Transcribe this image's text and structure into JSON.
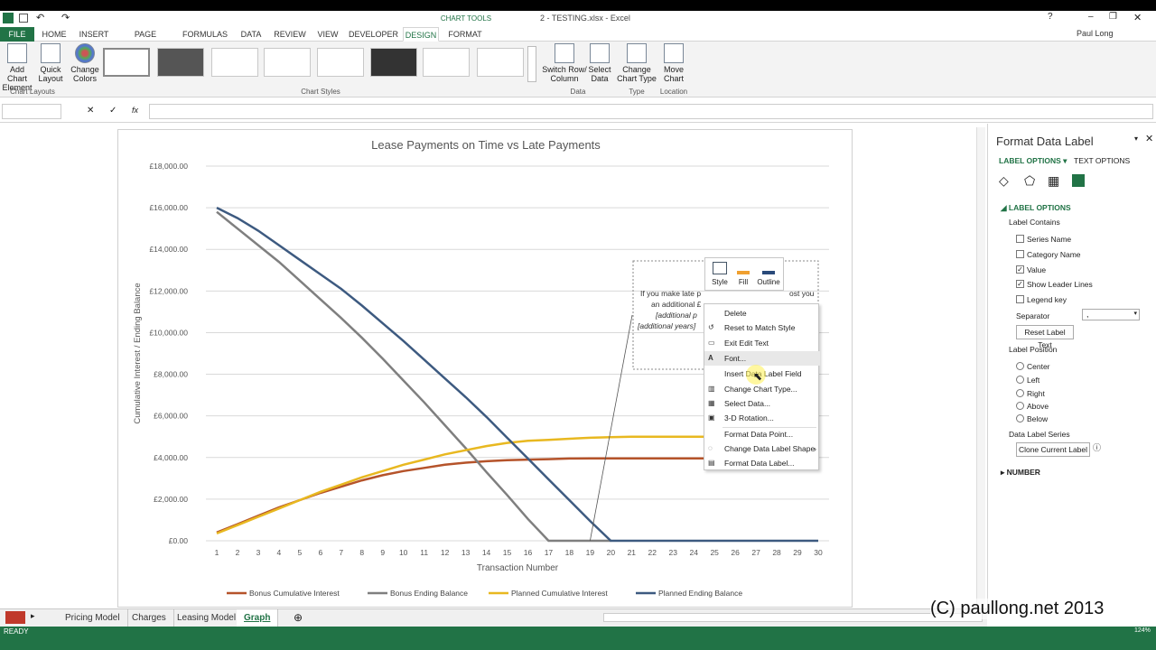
{
  "window": {
    "title": "2 - TESTING.xlsx - Excel",
    "user": "Paul Long",
    "chart_tools": "CHART TOOLS"
  },
  "tabs": [
    "HOME",
    "INSERT",
    "PAGE LAYOUT",
    "FORMULAS",
    "DATA",
    "REVIEW",
    "VIEW",
    "DEVELOPER",
    "DESIGN",
    "FORMAT"
  ],
  "file_tab": "FILE",
  "ribbon": {
    "add_chart_element": "Add Chart\nElement",
    "quick_layout": "Quick\nLayout",
    "change_colors": "Change\nColors",
    "switch_row_col": "Switch Row/\nColumn",
    "select_data": "Select\nData",
    "change_chart_type": "Change\nChart Type",
    "move_chart": "Move\nChart",
    "groups": {
      "chart_layouts": "Chart Layouts",
      "chart_styles": "Chart Styles",
      "data": "Data",
      "type": "Type",
      "location": "Location"
    }
  },
  "formula_bar": {
    "cancel": "✕",
    "enter": "✓",
    "fx": "fx",
    "name_box": "",
    "formula": ""
  },
  "chart_data": {
    "type": "line",
    "title": "Lease Payments on Time vs Late Payments",
    "xlabel": "Transaction Number",
    "ylabel": "Cumulative Interest / Ending Balance",
    "x": [
      1,
      2,
      3,
      4,
      5,
      6,
      7,
      8,
      9,
      10,
      11,
      12,
      13,
      14,
      15,
      16,
      17,
      18,
      19,
      20,
      21,
      22,
      23,
      24,
      25,
      26,
      27,
      28,
      29,
      30
    ],
    "ylim": [
      0,
      18000
    ],
    "yticks": [
      "£0.00",
      "£2,000.00",
      "£4,000.00",
      "£6,000.00",
      "£8,000.00",
      "£10,000.00",
      "£12,000.00",
      "£14,000.00",
      "£16,000.00",
      "£18,000.00"
    ],
    "grid": true,
    "legend_placement": "bottom",
    "series": [
      {
        "name": "Bonus Cumulative Interest",
        "color": "#b5532a",
        "values": [
          400,
          800,
          1200,
          1600,
          1950,
          2300,
          2600,
          2900,
          3150,
          3350,
          3500,
          3650,
          3750,
          3820,
          3870,
          3900,
          3920,
          3950,
          3960,
          3960,
          3960,
          3960,
          3960,
          3960,
          3960,
          3960,
          3960,
          3960,
          3960,
          3960
        ]
      },
      {
        "name": "Bonus Ending Balance",
        "color": "#7f7f7f",
        "values": [
          15800,
          15000,
          14200,
          13400,
          12500,
          11600,
          10700,
          9750,
          8750,
          7700,
          6650,
          5550,
          4450,
          3300,
          2200,
          1050,
          0,
          0,
          0,
          0
        ]
      },
      {
        "name": "Planned Cumulative Interest",
        "color": "#e8b820",
        "values": [
          350,
          750,
          1150,
          1550,
          1950,
          2350,
          2700,
          3050,
          3350,
          3650,
          3900,
          4150,
          4350,
          4550,
          4700,
          4800,
          4850,
          4900,
          4950,
          4980,
          5000,
          5000,
          5000,
          5000,
          5000,
          5000,
          5000,
          5000,
          5000,
          5000
        ]
      },
      {
        "name": "Planned Ending Balance",
        "color": "#3d5a80",
        "values": [
          16000,
          15500,
          14900,
          14200,
          13500,
          12800,
          12100,
          11300,
          10450,
          9600,
          8700,
          7800,
          6900,
          5950,
          4950,
          3950,
          2950,
          1950,
          950,
          0,
          0,
          0,
          0,
          0,
          0,
          0,
          0,
          0,
          0,
          0
        ]
      }
    ],
    "annotation": {
      "line1": "If you make late p",
      "line1b": "ost you",
      "line2": "an additional £",
      "line3": "[additional p",
      "line4": "[additional years]"
    }
  },
  "mini_toolbar": {
    "style": "Style",
    "fill": "Fill",
    "outline": "Outline"
  },
  "context_menu": [
    "Delete",
    "Reset to Match Style",
    "Exit Edit Text",
    "Font...",
    "Insert Data Label Field",
    "Change Chart Type...",
    "Select Data...",
    "3-D Rotation...",
    "Format Data Point...",
    "Change Data Label Shape",
    "Format Data Label..."
  ],
  "pane": {
    "title": "Format Data Label",
    "label_options_tab": "LABEL OPTIONS",
    "text_options_tab": "TEXT OPTIONS",
    "section": "LABEL OPTIONS",
    "label_contains": "Label Contains",
    "checkboxes": [
      {
        "label": "Series Name",
        "checked": false
      },
      {
        "label": "Category Name",
        "checked": false
      },
      {
        "label": "Value",
        "checked": true
      },
      {
        "label": "Show Leader Lines",
        "checked": true
      },
      {
        "label": "Legend key",
        "checked": false
      }
    ],
    "separator_label": "Separator",
    "separator_value": ",",
    "reset_button": "Reset Label Text",
    "label_position": "Label Position",
    "positions": [
      "Center",
      "Left",
      "Right",
      "Above",
      "Below"
    ],
    "data_label_series": "Data Label Series",
    "clone_button": "Clone Current Label",
    "number": "NUMBER"
  },
  "sheet_tabs": [
    "Pricing Model",
    "Charges",
    "Leasing Model",
    "Graph"
  ],
  "active_sheet": "Graph",
  "status": {
    "ready": "READY",
    "zoom": "124%"
  },
  "watermark": "(C) paullong.net 2013"
}
